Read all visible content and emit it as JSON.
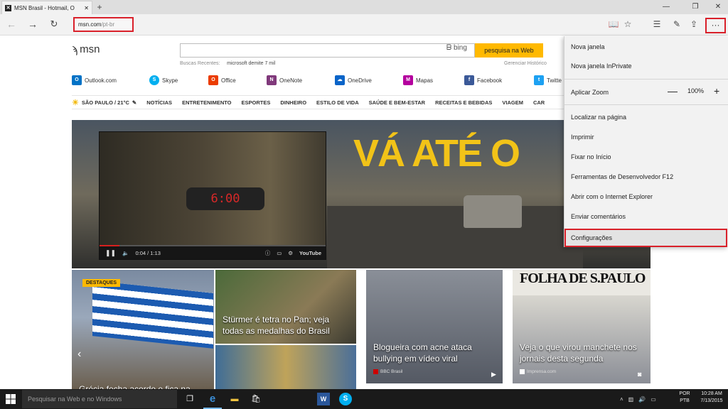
{
  "browser": {
    "tab_title": "MSN Brasil - Hotmail, O",
    "tab_favicon": "msn-icon",
    "new_tab": "+",
    "url_host": "msn.com",
    "url_path": "/pt-br"
  },
  "msn": {
    "logo_text": "msn",
    "search_button": "pesquisa na Web",
    "bing_label": "bing",
    "recent_label": "Buscas Recentes:",
    "recent_query": "microsoft demite 7 mil",
    "history_link": "Gerenciar Histórico",
    "quicklinks": [
      "Outlook.com",
      "Skype",
      "Office",
      "OneNote",
      "OneDrive",
      "Mapas",
      "Facebook",
      "Twitte"
    ],
    "weather": "SÃO PAULO / 21°C",
    "categories": [
      "NOTÍCIAS",
      "ENTRETENIMENTO",
      "ESPORTES",
      "DINHEIRO",
      "ESTILO DE VIDA",
      "SAÚDE E BEM-ESTAR",
      "RECEITAS E BEBIDAS",
      "VIAGEM",
      "CAR"
    ],
    "hero_text": "VÁ ATÉ O",
    "video_clock": "6:00",
    "video_time": "0:04 / 1:13",
    "video_brand": "YouTube",
    "badge": "DESTAQUES",
    "tile1_caption": "Grécia fecha acordo e fica na",
    "tile2_caption": "Stürmer é tetra no Pan; veja todas as medalhas do Brasil",
    "tile4_caption": "Blogueira com acne ataca bullying em vídeo viral",
    "tile4_source": "BBC Brasil",
    "tile5_paper": "FOLHA DE S.PAULO",
    "tile5_caption": "Veja o que virou manchete nos jornais desta segunda",
    "tile5_source": "Imprensa.com"
  },
  "menu": {
    "new_window": "Nova janela",
    "new_inprivate": "Nova janela InPrivate",
    "zoom_label": "Aplicar Zoom",
    "zoom_minus": "—",
    "zoom_value": "100%",
    "zoom_plus": "+",
    "find": "Localizar na página",
    "print": "Imprimir",
    "pin": "Fixar no Início",
    "devtools": "Ferramentas de Desenvolvedor F12",
    "open_ie": "Abrir com o Internet Explorer",
    "feedback": "Enviar comentários",
    "settings": "Configurações"
  },
  "taskbar": {
    "search_placeholder": "Pesquisar na Web e no Windows",
    "lang_top": "POR",
    "lang_bottom": "PTB",
    "time": "10:28 AM",
    "date": "7/13/2015"
  }
}
